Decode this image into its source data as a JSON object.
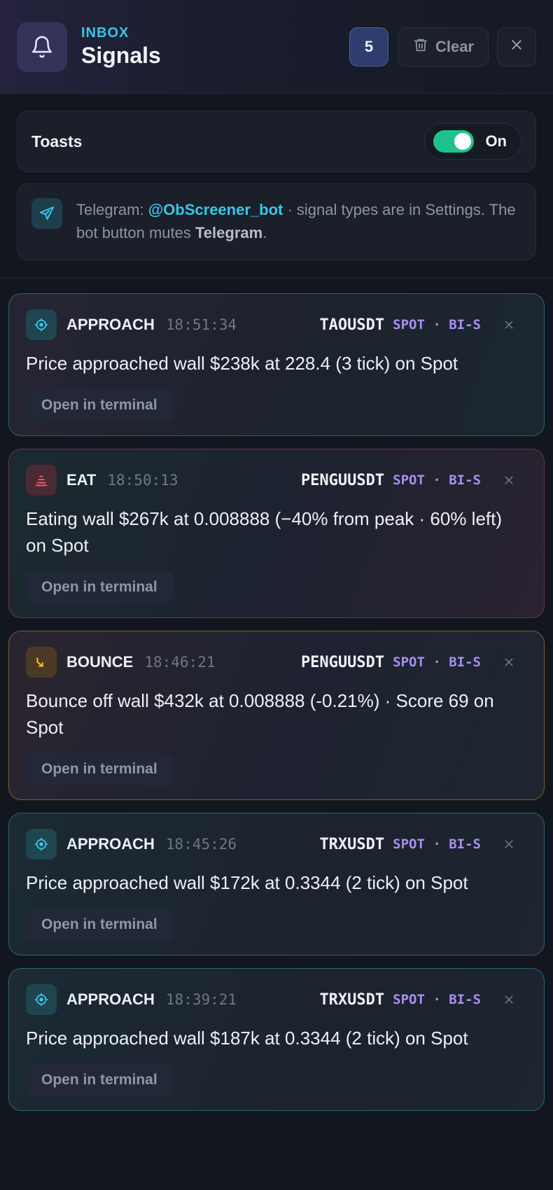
{
  "header": {
    "eyebrow": "INBOX",
    "title": "Signals",
    "count": "5",
    "clear_label": "Clear",
    "icons": {
      "bell": "bell-icon",
      "trash": "trash-icon",
      "close": "close-icon"
    }
  },
  "settings": {
    "toasts_label": "Toasts",
    "toasts_state": "On",
    "toasts_enabled": true,
    "telegram": {
      "prefix": "Telegram: ",
      "handle": "@ObScreener_bot",
      "middle": " · signal types are in Settings. The bot button mutes ",
      "strong": "Telegram",
      "suffix": "."
    }
  },
  "colors": {
    "accent_cyan": "#38c6e8",
    "toggle_green": "#1fc28f",
    "market_purple": "#a98ef0",
    "approach_border": "#2c6472",
    "eat_border": "#6a3446",
    "bounce_border": "#7a6030"
  },
  "signals": [
    {
      "type": "APPROACH",
      "time": "18:51:34",
      "symbol": "TAOUSDT",
      "market": "SPOT · BI-S",
      "message": "Price approached wall $238k at 228.4 (3 tick) on Spot",
      "action": "Open in terminal"
    },
    {
      "type": "EAT",
      "time": "18:50:13",
      "symbol": "PENGUUSDT",
      "market": "SPOT · BI-S",
      "message": "Eating wall $267k at 0.008888 (−40% from peak · 60% left) on Spot",
      "action": "Open in terminal"
    },
    {
      "type": "BOUNCE",
      "time": "18:46:21",
      "symbol": "PENGUUSDT",
      "market": "SPOT · BI-S",
      "message": "Bounce off wall $432k at 0.008888 (-0.21%) · Score 69 on Spot",
      "action": "Open in terminal"
    },
    {
      "type": "APPROACH",
      "time": "18:45:26",
      "symbol": "TRXUSDT",
      "market": "SPOT · BI-S",
      "message": "Price approached wall $172k at 0.3344 (2 tick) on Spot",
      "action": "Open in terminal"
    },
    {
      "type": "APPROACH",
      "time": "18:39:21",
      "symbol": "TRXUSDT",
      "market": "SPOT · BI-S",
      "message": "Price approached wall $187k at 0.3344 (2 tick) on Spot",
      "action": "Open in terminal"
    }
  ]
}
